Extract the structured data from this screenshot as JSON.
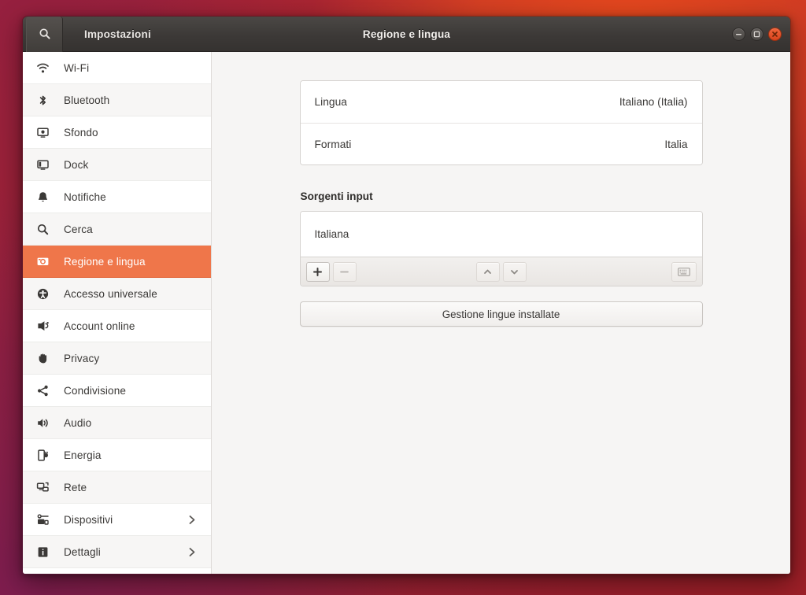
{
  "window": {
    "left_title": "Impostazioni",
    "center_title": "Regione e lingua",
    "search_icon": "search-icon",
    "controls": {
      "minimize": "minimize-icon",
      "maximize": "maximize-icon",
      "close": "close-icon"
    }
  },
  "sidebar": {
    "items": [
      {
        "label": "Wi-Fi",
        "icon": "wifi-icon",
        "selected": false,
        "chevron": false
      },
      {
        "label": "Bluetooth",
        "icon": "bluetooth-icon",
        "selected": false,
        "chevron": false
      },
      {
        "label": "Sfondo",
        "icon": "background-icon",
        "selected": false,
        "chevron": false
      },
      {
        "label": "Dock",
        "icon": "dock-icon",
        "selected": false,
        "chevron": false
      },
      {
        "label": "Notifiche",
        "icon": "bell-icon",
        "selected": false,
        "chevron": false
      },
      {
        "label": "Cerca",
        "icon": "search-icon",
        "selected": false,
        "chevron": false
      },
      {
        "label": "Regione e lingua",
        "icon": "region-language-icon",
        "selected": true,
        "chevron": false
      },
      {
        "label": "Accesso universale",
        "icon": "accessibility-icon",
        "selected": false,
        "chevron": false
      },
      {
        "label": "Account online",
        "icon": "online-accounts-icon",
        "selected": false,
        "chevron": false
      },
      {
        "label": "Privacy",
        "icon": "hand-icon",
        "selected": false,
        "chevron": false
      },
      {
        "label": "Condivisione",
        "icon": "share-icon",
        "selected": false,
        "chevron": false
      },
      {
        "label": "Audio",
        "icon": "speaker-icon",
        "selected": false,
        "chevron": false
      },
      {
        "label": "Energia",
        "icon": "power-icon",
        "selected": false,
        "chevron": false
      },
      {
        "label": "Rete",
        "icon": "network-icon",
        "selected": false,
        "chevron": false
      },
      {
        "label": "Dispositivi",
        "icon": "devices-icon",
        "selected": false,
        "chevron": true
      },
      {
        "label": "Dettagli",
        "icon": "details-icon",
        "selected": false,
        "chevron": true
      }
    ]
  },
  "main": {
    "settings_rows": [
      {
        "label": "Lingua",
        "value": "Italiano (Italia)"
      },
      {
        "label": "Formati",
        "value": "Italia"
      }
    ],
    "input_sources": {
      "section_title": "Sorgenti input",
      "items": [
        "Italiana"
      ],
      "toolbar": {
        "add": "+",
        "remove": "−",
        "move_up": "chevron-up-icon",
        "move_down": "chevron-down-icon",
        "show_keyboard": "keyboard-icon"
      }
    },
    "manage_languages_button": "Gestione lingue installate"
  },
  "colors": {
    "accent": "#ef764a",
    "close_button": "#e0501f",
    "titlebar": "#3c3937",
    "sidebar_bg": "#ffffff",
    "content_bg": "#f6f5f4"
  }
}
